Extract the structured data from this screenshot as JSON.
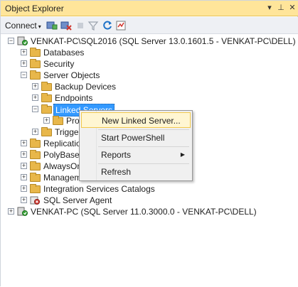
{
  "window": {
    "title": "Object Explorer",
    "pin_glyph": "▾",
    "autohide_glyph": "⊥",
    "close_glyph": "✕"
  },
  "toolbar": {
    "connect_label": "Connect",
    "connect_caret": "▾",
    "icons": [
      "connect-object-icon",
      "disconnect-icon",
      "stop-icon",
      "filter-icon",
      "refresh-icon",
      "activity-monitor-icon"
    ]
  },
  "tree": [
    {
      "label": "VENKAT-PC\\SQL2016 (SQL Server 13.0.1601.5 - VENKAT-PC\\DELL)",
      "expander": "−",
      "icon": "server-icon"
    },
    {
      "label": "Databases",
      "expander": "+",
      "icon": "folder-icon"
    },
    {
      "label": "Security",
      "expander": "+",
      "icon": "folder-icon"
    },
    {
      "label": "Server Objects",
      "expander": "−",
      "icon": "folder-icon"
    },
    {
      "label": "Backup Devices",
      "expander": "+",
      "icon": "folder-icon"
    },
    {
      "label": "Endpoints",
      "expander": "+",
      "icon": "folder-icon"
    },
    {
      "label": "Linked Servers",
      "expander": "−",
      "icon": "folder-icon"
    },
    {
      "label": "Pro",
      "expander": "+",
      "icon": "folder-icon"
    },
    {
      "label": "Trigge",
      "expander": "+",
      "icon": "folder-icon"
    },
    {
      "label": "Replication",
      "expander": "+",
      "icon": "folder-icon"
    },
    {
      "label": "PolyBase",
      "expander": "+",
      "icon": "folder-icon"
    },
    {
      "label": "AlwaysOn",
      "expander": "+",
      "icon": "folder-icon"
    },
    {
      "label": "Managem",
      "expander": "+",
      "icon": "folder-icon"
    },
    {
      "label": "Integration Services Catalogs",
      "expander": "+",
      "icon": "folder-icon"
    },
    {
      "label": "SQL Server Agent",
      "expander": "+",
      "icon": "agent-icon"
    },
    {
      "label": "VENKAT-PC (SQL Server 11.0.3000.0 - VENKAT-PC\\DELL)",
      "expander": "+",
      "icon": "server-icon"
    }
  ],
  "context_menu": {
    "items": [
      {
        "label": "New Linked Server..."
      },
      {
        "label": "Start PowerShell"
      },
      {
        "label": "Reports",
        "submenu_arrow": "▶"
      },
      {
        "label": "Refresh"
      }
    ]
  },
  "colors": {
    "titlebar": "#ffe59a",
    "selection": "#3399ff",
    "menu_highlight": "#fff6d2"
  }
}
